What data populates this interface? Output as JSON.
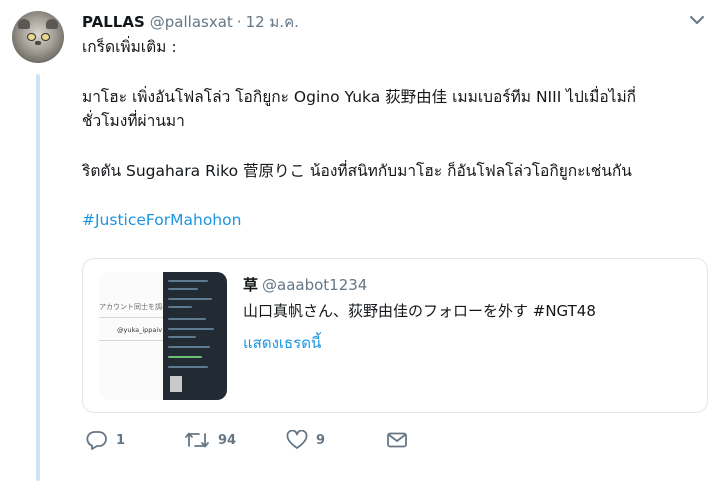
{
  "tweet": {
    "author_name": "PALLAS",
    "author_handle": "@pallasxat",
    "separator": "·",
    "timestamp": "12 ม.ค.",
    "lines": [
      "เกร็ดเพิ่มเติม :",
      "มาโฮะ เพิ่งอันโฟลโล่ว โอกิยูกะ Ogino Yuka 荻野由佳 เมมเบอร์ทีม NIII ไปเมื่อไม่กี่",
      "ชั่วโมงที่ผ่านมา",
      "ริตตัน Sugahara Riko 菅原りこ น้องที่สนิทกับมาโฮะ ก็อันโฟลโล่วโอกิยูกะเช่นกัน"
    ],
    "hashtag": "#JusticeForMahohon"
  },
  "quoted": {
    "author_name": "草",
    "author_handle": "@aaabot1234",
    "text": "山口真帆さん、荻野由佳のフォローを外す #NGT48",
    "show_thread": "แสดงเธรดนี้",
    "thumb_caption": "アカウント同士を調べ",
    "thumb_tag": "@yuka_ippaiv"
  },
  "actions": {
    "reply_count": "1",
    "retweet_count": "94",
    "like_count": "9"
  },
  "icons": {
    "caret": "chevron-down-icon",
    "reply": "reply-icon",
    "retweet": "retweet-icon",
    "like": "heart-icon",
    "dm": "envelope-icon"
  },
  "colors": {
    "link": "#1b95e0",
    "secondary": "#657786",
    "thread_line": "#cce3f5",
    "border": "#e1e8ed"
  }
}
